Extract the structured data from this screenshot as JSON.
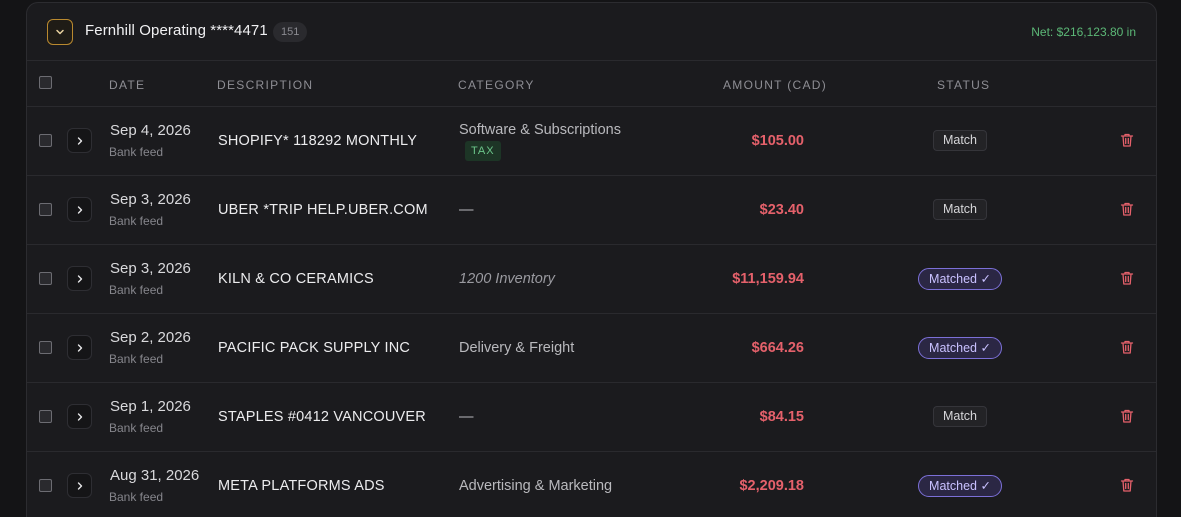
{
  "account": {
    "title": "Fernhill Operating ****4471",
    "count": "151",
    "net_total": "Net: $216,123.80 in"
  },
  "columns": {
    "date": "DATE",
    "description": "DESCRIPTION",
    "category": "CATEGORY",
    "amount": "AMOUNT (CAD)",
    "status": "STATUS"
  },
  "colors": {
    "accent_gold": "#b9892f",
    "amount_red": "#e5616b",
    "net_green": "#5cb877",
    "matched_purple": "#7c70d8",
    "tax_green": "#6cc58a"
  },
  "rows": [
    {
      "date": "Sep 4, 2026",
      "source": "Bank feed",
      "description": "SHOPIFY* 118292 MONTHLY",
      "category": "Software & Subscriptions",
      "category_badge": "TAX",
      "amount": "$105.00",
      "status": "Match"
    },
    {
      "date": "Sep 3, 2026",
      "source": "Bank feed",
      "description": "UBER *TRIP HELP.UBER.COM",
      "category": "—",
      "amount": "$23.40",
      "status": "Match"
    },
    {
      "date": "Sep 3, 2026",
      "source": "Bank feed",
      "description": "KILN & CO CERAMICS",
      "category": "1200 Inventory",
      "amount": "$11,159.94",
      "status": "Matched ✓"
    },
    {
      "date": "Sep 2, 2026",
      "source": "Bank feed",
      "description": "PACIFIC PACK SUPPLY INC",
      "category": "Delivery & Freight",
      "amount": "$664.26",
      "status": "Matched ✓"
    },
    {
      "date": "Sep 1, 2026",
      "source": "Bank feed",
      "description": "STAPLES #0412 VANCOUVER",
      "category": "—",
      "amount": "$84.15",
      "status": "Match"
    },
    {
      "date": "Aug 31, 2026",
      "source": "Bank feed",
      "description": "META PLATFORMS ADS",
      "category": "Advertising & Marketing",
      "amount": "$2,209.18",
      "status": "Matched ✓"
    }
  ],
  "icons": {
    "collapse": "chevron-down-icon",
    "expand": "chevron-right-icon",
    "delete": "trash-icon"
  }
}
